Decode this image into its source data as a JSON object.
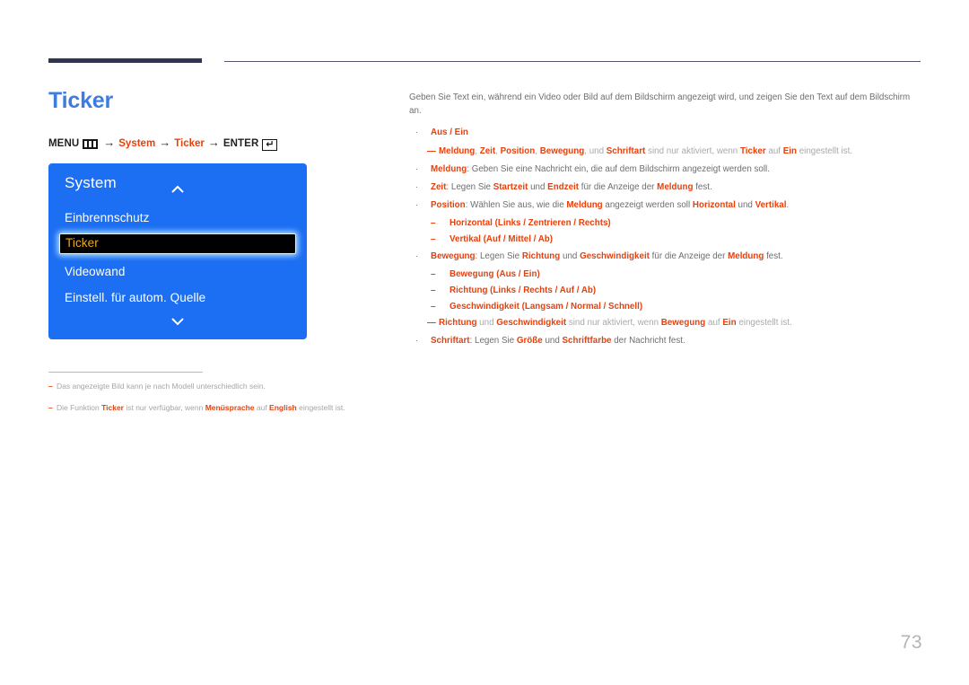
{
  "page": {
    "title": "Ticker",
    "number": "73",
    "accent_color": "#e8400c",
    "title_color": "#3f7ce0",
    "rule_color": "#2e3550"
  },
  "menu_path": {
    "menu_label": "MENU",
    "menu_icon": "menu-grid-icon",
    "arrow": "→",
    "step1": "System",
    "step2": "Ticker",
    "enter_label": "ENTER",
    "enter_icon": "enter-return-icon",
    "enter_glyph": "↵"
  },
  "tv_menu": {
    "title": "System",
    "scroll_up_icon": "chevron-up-icon",
    "scroll_down_icon": "chevron-down-icon",
    "background_color": "#1c6ef2",
    "selected_text_color": "#f0a818",
    "items": [
      {
        "label": "Einbrennschutz",
        "selected": false
      },
      {
        "label": "Ticker",
        "selected": true
      },
      {
        "label": "Videowand",
        "selected": false
      },
      {
        "label": "Einstell. für autom. Quelle",
        "selected": false
      }
    ]
  },
  "content": {
    "intro": "Geben Sie Text ein, während ein Video oder Bild auf dem Bildschirm angezeigt wird, und zeigen Sie den Text auf dem Bildschirm an.",
    "b1_label": "Aus / Ein",
    "n1_p1": "Meldung",
    "n1_p2": ", ",
    "n1_p3": "Zeit",
    "n1_p4": ", ",
    "n1_p5": "Position",
    "n1_p6": ", ",
    "n1_p7": "Bewegung",
    "n1_p8": ", und ",
    "n1_p9": "Schriftart",
    "n1_p10": " sind nur aktiviert, wenn ",
    "n1_p11": "Ticker",
    "n1_p12": " auf ",
    "n1_p13": "Ein",
    "n1_p14": " eingestellt ist.",
    "b2_label": "Meldung",
    "b2_rest": ": Geben Sie eine Nachricht ein, die auf dem Bildschirm angezeigt werden soll.",
    "b3_label": "Zeit",
    "b3_t1": ": Legen Sie ",
    "b3_a1": "Startzeit",
    "b3_t2": " und ",
    "b3_a2": "Endzeit",
    "b3_t3": " für die Anzeige der ",
    "b3_a3": "Meldung",
    "b3_t4": " fest.",
    "b4_label": "Position",
    "b4_t1": ": Wählen Sie aus, wie die ",
    "b4_a1": "Meldung",
    "b4_t2": " angezeigt werden soll ",
    "b4_a2": "Horizontal",
    "b4_t3": " und ",
    "b4_a3": "Vertikal",
    "b4_t4": ".",
    "s1_label": "Horizontal",
    "s1_open": " (",
    "s1_o1": "Links",
    "s1_sep1": " / ",
    "s1_o2": "Zentrieren",
    "s1_sep2": " / ",
    "s1_o3": "Rechts",
    "s1_close": ")",
    "s2_label": "Vertikal",
    "s2_open": " (",
    "s2_o1": "Auf",
    "s2_sep1": " / ",
    "s2_o2": "Mittel",
    "s2_sep2": " / ",
    "s2_o3": "Ab",
    "s2_close": ")",
    "b5_label": "Bewegung",
    "b5_t1": ": Legen Sie ",
    "b5_a1": "Richtung",
    "b5_t2": " und ",
    "b5_a2": "Geschwindigkeit",
    "b5_t3": " für die Anzeige der ",
    "b5_a3": "Meldung",
    "b5_t4": " fest.",
    "s3_label": "Bewegung",
    "s3_open": " (",
    "s3_o1": "Aus",
    "s3_sep1": " / ",
    "s3_o2": "Ein",
    "s3_close": ")",
    "s4_label": "Richtung",
    "s4_open": " (",
    "s4_o1": "Links",
    "s4_sep1": " / ",
    "s4_o2": "Rechts",
    "s4_sep2": " / ",
    "s4_o3": "Auf",
    "s4_sep3": " / ",
    "s4_o4": "Ab",
    "s4_close": ")",
    "s5_label": "Geschwindigkeit",
    "s5_open": " (",
    "s5_o1": "Langsam",
    "s5_sep1": " / ",
    "s5_o2": "Normal",
    "s5_sep2": " / ",
    "s5_o3": "Schnell",
    "s5_close": ")",
    "n2_p1": "Richtung",
    "n2_p2": " und ",
    "n2_p3": "Geschwindigkeit",
    "n2_p4": " sind nur aktiviert, wenn ",
    "n2_p5": "Bewegung",
    "n2_p6": " auf ",
    "n2_p7": "Ein",
    "n2_p8": " eingestellt ist.",
    "b6_label": "Schriftart",
    "b6_t1": ": Legen Sie ",
    "b6_a1": "Größe",
    "b6_t2": " und ",
    "b6_a2": "Schriftfarbe",
    "b6_t3": " der Nachricht fest.",
    "bullet_glyph": "·",
    "dash_glyph": "–",
    "note_glyph": "—"
  },
  "footnotes": [
    {
      "dash": "–",
      "p1": "Das angezeigte Bild kann je nach Modell unterschiedlich sein."
    },
    {
      "dash": "–",
      "p1": "Die Funktion ",
      "a1": "Ticker",
      "p2": " ist nur verfügbar, wenn ",
      "a2": "Menüsprache",
      "p3": " auf ",
      "a3": "English",
      "p4": " eingestellt ist."
    }
  ]
}
